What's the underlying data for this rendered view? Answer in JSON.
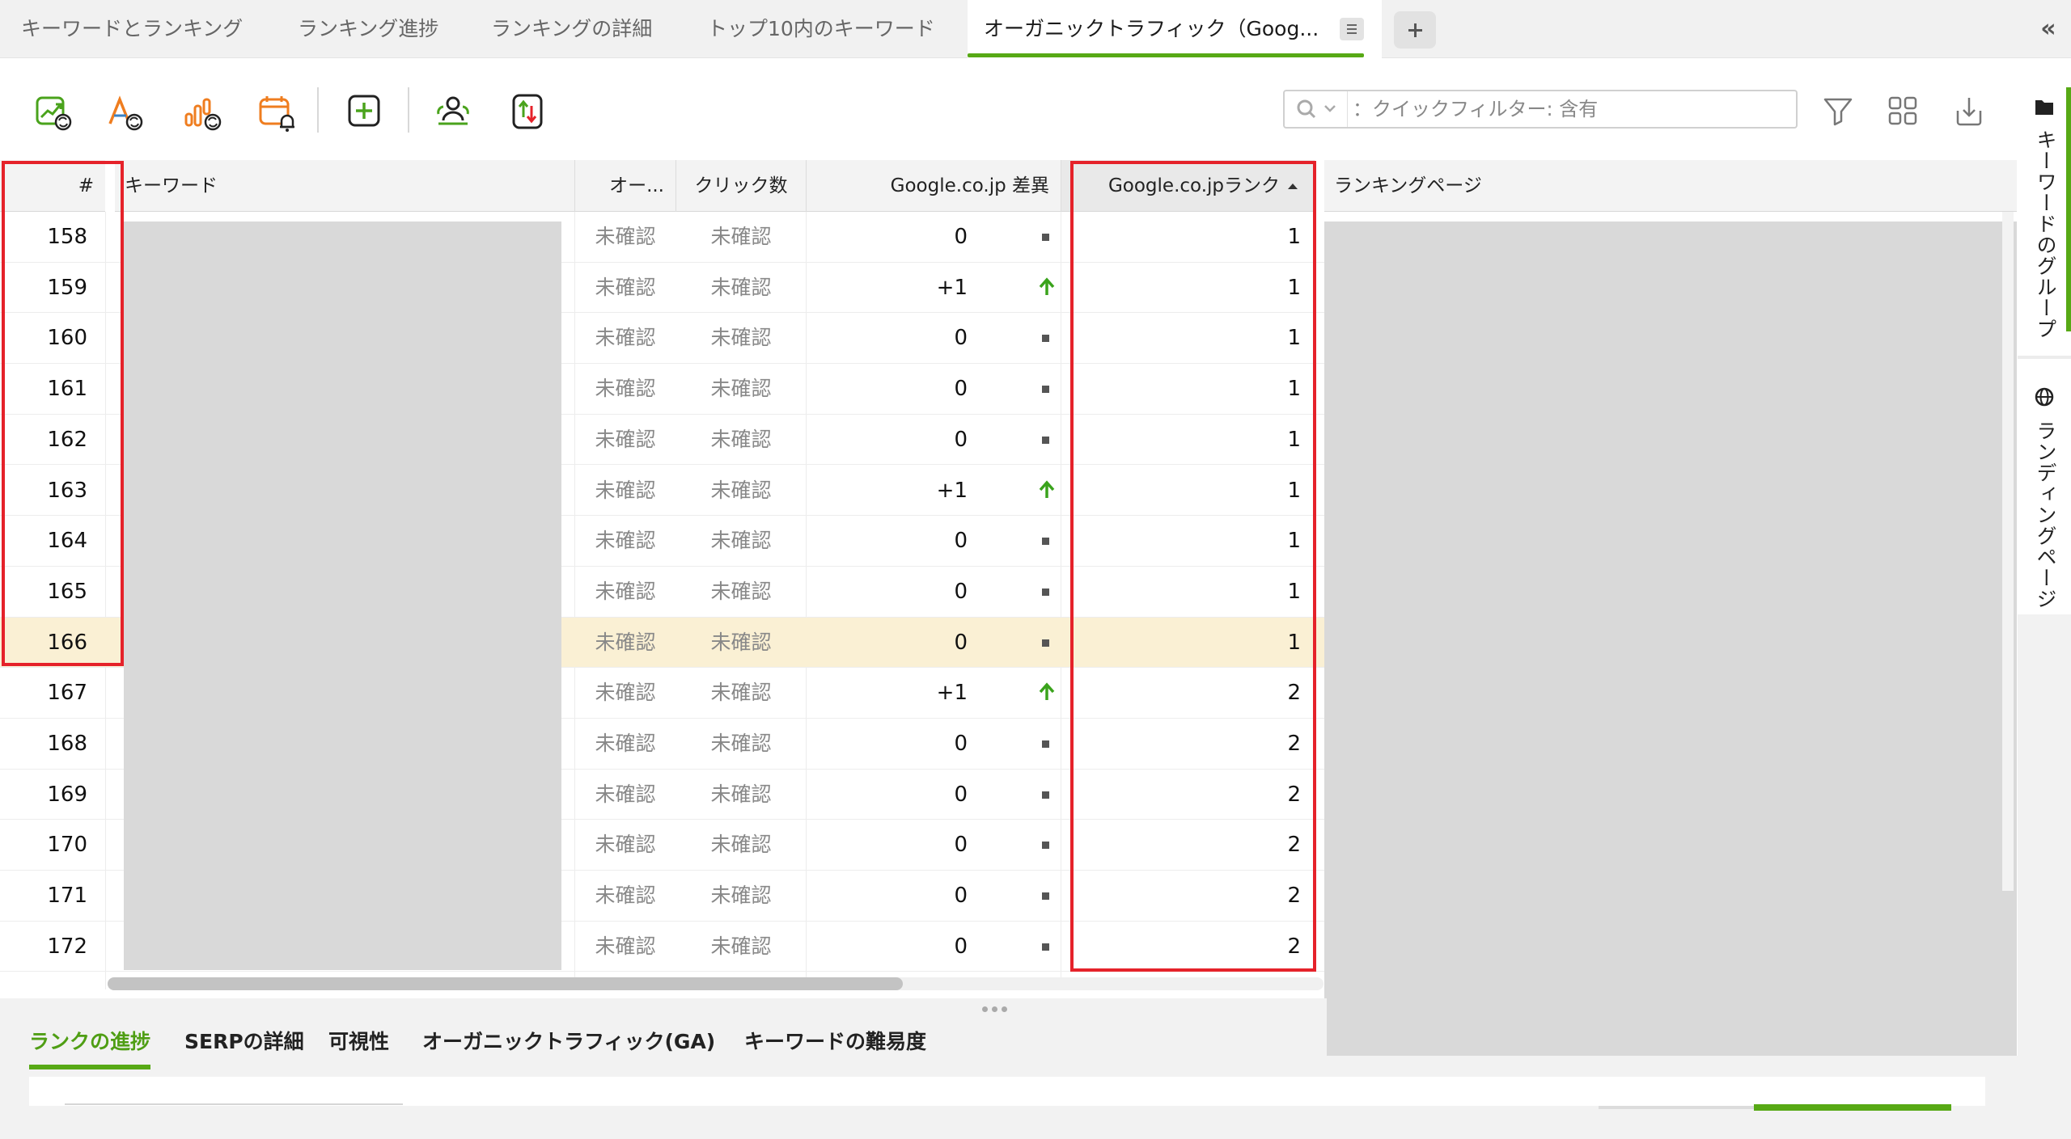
{
  "tabs": [
    {
      "label": "キーワードとランキング",
      "active": false
    },
    {
      "label": "ランキング進捗",
      "active": false
    },
    {
      "label": "ランキングの詳細",
      "active": false
    },
    {
      "label": "トップ10内のキーワード",
      "active": false
    },
    {
      "label": "オーガニックトラフィック（Goog...",
      "active": true
    }
  ],
  "toolbar": {
    "icons": [
      "update-rankings-icon",
      "update-keywords-icon",
      "update-traffic-icon",
      "schedule-icon",
      "add-keywords-icon",
      "competitors-icon",
      "import-export-icon"
    ],
    "search_placeholder": "：クイックフィルター: 含有",
    "right_icons": [
      "filter-icon",
      "columns-icon",
      "export-icon"
    ]
  },
  "grid": {
    "headers": {
      "num": "#",
      "keyword": "キーワード",
      "organic": "オー...",
      "clicks": "クリック数",
      "diff": "Google.co.jp 差異",
      "rank": "Google.co.jpランク",
      "page": "ランキングページ"
    },
    "sorted_column": "rank",
    "sort_direction": "ascending",
    "highlighted_row": "166",
    "rows": [
      {
        "num": "158",
        "organic": "未確認",
        "clicks": "未確認",
        "diff": "0",
        "trend": "none",
        "rank": "1"
      },
      {
        "num": "159",
        "organic": "未確認",
        "clicks": "未確認",
        "diff": "+1",
        "trend": "up",
        "rank": "1"
      },
      {
        "num": "160",
        "organic": "未確認",
        "clicks": "未確認",
        "diff": "0",
        "trend": "none",
        "rank": "1"
      },
      {
        "num": "161",
        "organic": "未確認",
        "clicks": "未確認",
        "diff": "0",
        "trend": "none",
        "rank": "1"
      },
      {
        "num": "162",
        "organic": "未確認",
        "clicks": "未確認",
        "diff": "0",
        "trend": "none",
        "rank": "1"
      },
      {
        "num": "163",
        "organic": "未確認",
        "clicks": "未確認",
        "diff": "+1",
        "trend": "up",
        "rank": "1"
      },
      {
        "num": "164",
        "organic": "未確認",
        "clicks": "未確認",
        "diff": "0",
        "trend": "none",
        "rank": "1"
      },
      {
        "num": "165",
        "organic": "未確認",
        "clicks": "未確認",
        "diff": "0",
        "trend": "none",
        "rank": "1"
      },
      {
        "num": "166",
        "organic": "未確認",
        "clicks": "未確認",
        "diff": "0",
        "trend": "none",
        "rank": "1"
      },
      {
        "num": "167",
        "organic": "未確認",
        "clicks": "未確認",
        "diff": "+1",
        "trend": "up",
        "rank": "2"
      },
      {
        "num": "168",
        "organic": "未確認",
        "clicks": "未確認",
        "diff": "0",
        "trend": "none",
        "rank": "2"
      },
      {
        "num": "169",
        "organic": "未確認",
        "clicks": "未確認",
        "diff": "0",
        "trend": "none",
        "rank": "2"
      },
      {
        "num": "170",
        "organic": "未確認",
        "clicks": "未確認",
        "diff": "0",
        "trend": "none",
        "rank": "2"
      },
      {
        "num": "171",
        "organic": "未確認",
        "clicks": "未確認",
        "diff": "0",
        "trend": "none",
        "rank": "2"
      },
      {
        "num": "172",
        "organic": "未確認",
        "clicks": "未確認",
        "diff": "0",
        "trend": "none",
        "rank": "2"
      }
    ]
  },
  "bottom_tabs": [
    {
      "label": "ランクの進捗",
      "active": true
    },
    {
      "label": "SERPの詳細",
      "active": false
    },
    {
      "label": "可視性",
      "active": false
    },
    {
      "label": "オーガニックトラフィック(GA)",
      "active": false
    },
    {
      "label": "キーワードの難易度",
      "active": false
    }
  ],
  "side_panel": {
    "keyword_groups": "キーワードのグループ",
    "landing_pages": "ランディングページ"
  },
  "colors": {
    "accent_green": "#57a915",
    "trend_up": "#3aa31c",
    "highlight_box": "#e5222a",
    "icon_orange": "#ef7d1f",
    "icon_green": "#4aa31c",
    "row_highlight": "#faf0d4"
  }
}
